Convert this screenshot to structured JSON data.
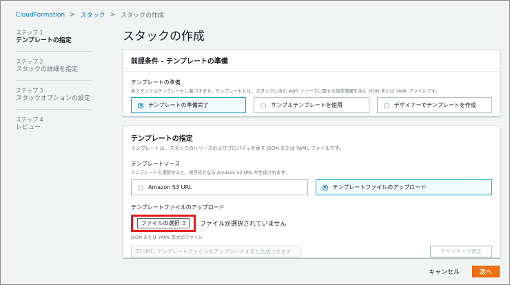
{
  "breadcrumb": {
    "items": [
      "CloudFormation",
      "スタック",
      "スタックの作成"
    ]
  },
  "sidebar": {
    "steps": [
      {
        "num": "ステップ 1",
        "label": "テンプレートの指定"
      },
      {
        "num": "ステップ 2",
        "label": "スタックの詳細を指定"
      },
      {
        "num": "ステップ 3",
        "label": "スタックオプションの設定"
      },
      {
        "num": "ステップ 4",
        "label": "レビュー"
      }
    ],
    "active_index": 0
  },
  "page_title": "スタックの作成",
  "prerequisite": {
    "header": "前提条件 - テンプレートの準備",
    "field_label": "テンプレートの準備",
    "field_desc": "各スタックはテンプレートに基づきます。テンプレートとは、スタックに含む AWS リソースに関する設定情報を含む JSON または YAML ファイルです。",
    "options": [
      {
        "label": "テンプレートの準備完了",
        "selected": true
      },
      {
        "label": "サンプルテンプレートを使用",
        "selected": false
      },
      {
        "label": "デザイナーでテンプレートを作成",
        "selected": false
      }
    ]
  },
  "specify": {
    "title": "テンプレートの指定",
    "desc": "テンプレートは、スタックのリソースおよびプロパティを表す JSON または YAML ファイルです。",
    "source_label": "テンプレートソース",
    "source_desc": "テンプレートを選択すると、保存先となる Amazon S3 URL が生成されます。",
    "source_options": [
      {
        "label": "Amazon S3 URL",
        "selected": false
      },
      {
        "label": "テンプレートファイルのアップロード",
        "selected": true
      }
    ],
    "upload_label": "テンプレートファイルのアップロード",
    "file_button": "ファイルの選択",
    "file_icon": "upload-icon",
    "no_file_text": "ファイルが選択されていません",
    "file_hint": "JSON または YAML 形式のファイル",
    "s3_url_placeholder": "S3 URL: テンプレートファイルをアップロードすると生成されます",
    "designer_button": "デザイナーで表示"
  },
  "footer": {
    "cancel": "キャンセル",
    "next": "次へ"
  },
  "colors": {
    "accent": "#0073bb",
    "primary_button": "#ec7211",
    "highlight_box": "#e51919"
  }
}
